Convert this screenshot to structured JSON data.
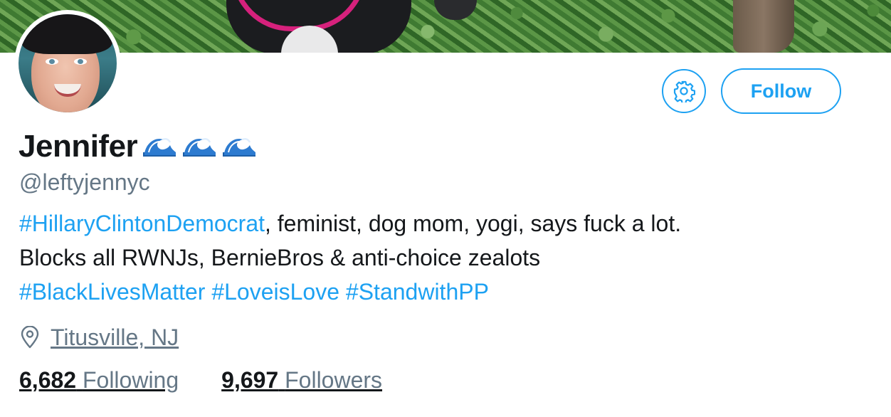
{
  "profile": {
    "name": "Jennifer",
    "name_emoji": [
      "wave-emoji-icon",
      "wave-emoji-icon",
      "wave-emoji-icon"
    ],
    "handle": "@leftyjennyc",
    "bio": {
      "line1_tag": "#HillaryClintonDemocrat",
      "line1_text": ", feminist, dog mom, yogi, says fuck a lot.",
      "line2_text": "Blocks all RWNJs, BernieBros & anti-choice zealots",
      "tags": [
        "#BlackLivesMatter",
        "#LoveisLove",
        "#StandwithPP"
      ]
    },
    "location": "Titusville, NJ"
  },
  "actions": {
    "settings_icon": "gear-icon",
    "follow_label": "Follow"
  },
  "stats": {
    "following_count": "6,682",
    "following_label": "Following",
    "followers_count": "9,697",
    "followers_label": "Followers"
  },
  "colors": {
    "accent": "#1da1f2",
    "secondary_text": "#657786",
    "primary_text": "#14171a"
  }
}
